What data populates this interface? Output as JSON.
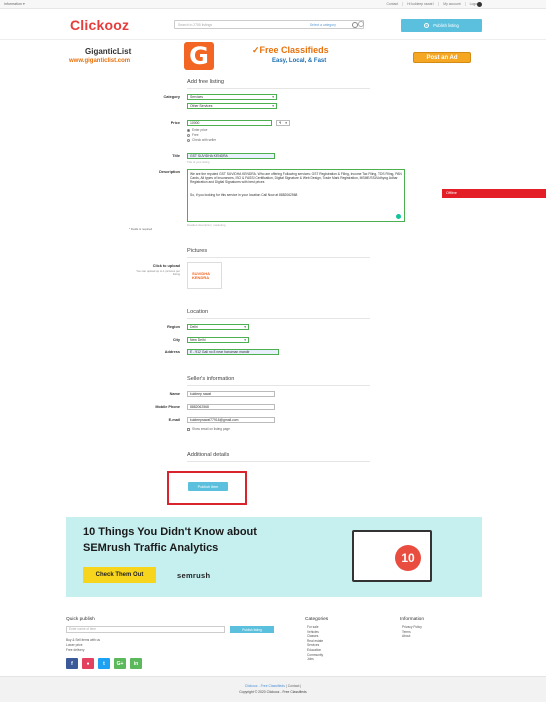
{
  "topbar": {
    "info": "Information ▾",
    "links": [
      "Contact",
      "Hi kuldeep rawat !",
      "My account",
      "Logout"
    ]
  },
  "header": {
    "logo": "Clickooz",
    "search_placeholder": "Search in 2755 listings",
    "search_category": "Select a category",
    "publish_listing": "Publish listing"
  },
  "banner": {
    "site_name": "GiganticList",
    "site_url": "www.giganticlist.com",
    "logo_letter": "G",
    "headline": "✓Free Classifieds",
    "tagline": "Easy, Local, & Fast",
    "post_ad": "Post an Ad"
  },
  "form": {
    "section_title": "Add free listing",
    "category_label": "Category",
    "category_value": "Services",
    "subcategory_value": "Other Services",
    "price_label": "Price",
    "price_value": "10000",
    "currency": "₹",
    "price_options": [
      "Enter price",
      "Free",
      "Check with seller"
    ],
    "title_label": "Title",
    "title_value": "GST SUVIDHA KENDRA",
    "title_hint": "Title of your listing",
    "description_label": "Description",
    "description_p1": "We are the reputed GST SUVIDHA KENDRA. Who are offering Following services: GST Registration & Filing, Income Tax Filing, TDS Filing, PAN Cards, All types of Insurances, ISO & FASSI Certification, Digital Signature & Web Design, Trade Mark Registration, MSME/SSI/Udhyog Adhar Registration and Digital Signatures with best prices",
    "description_p2": "So, if you looking for this service in your location Call Now at 8882062568",
    "description_hint": "Detailed description, marketing",
    "required_note": "* Fields is required",
    "pictures_title": "Pictures",
    "upload_label": "Click to upload",
    "upload_hint": "You can upload up to 1 pictures per listing",
    "thumb_text": "SUVIDHA KENDRA",
    "location_title": "Location",
    "region_label": "Region",
    "region_value": "Delhi",
    "city_label": "City",
    "city_value": "New Delhi",
    "address_label": "Address",
    "address_value": "E - 912 Gali no 8 near hanuman mandir",
    "seller_title": "Seller's information",
    "name_label": "Name",
    "name_value": "kuldeep rawat",
    "phone_label": "Mobile Phone",
    "phone_value": "8882062568",
    "email_label": "E-mail",
    "email_value": "kuldeeprawat77916@gmail.com",
    "show_email": "Show email on listing page",
    "additional_title": "Additional details",
    "publish_item": "Publish item"
  },
  "offline": "Offline",
  "ad": {
    "line1": "10 Things You Didn't Know about",
    "line2": "SEMrush Traffic Analytics",
    "cta": "Check Them Out",
    "brand": "semrush",
    "badge": "10"
  },
  "footer": {
    "quick_title": "Quick publish",
    "quick_placeholder": "Enter name of item",
    "quick_button": "Publish listing",
    "buy_sell": "Buy & Sell items with us",
    "lower_price": "Lower price",
    "free_delivery": "Free delivery",
    "social": [
      "f",
      "●",
      "t",
      "G+",
      "in"
    ],
    "categories_title": "Categories",
    "categories": [
      "For sale",
      "Vehicles",
      "Classes",
      "Real estate",
      "Services",
      "Education",
      "Community",
      "Jobs"
    ],
    "info_title": "Information",
    "info": [
      "Privacy Policy",
      "Terms",
      "About"
    ],
    "bottom_links": "Clickooz - Free Classifieds",
    "bottom_contact": "| Contact |",
    "copyright": "Copyright © 2020 Clickooz - Free Classifieds"
  },
  "colors": {
    "brand": "#e83c3c",
    "accent": "#5bc0de",
    "field_ok": "#4caf50",
    "highlight_box": "#d9232d",
    "offline": "#e41e26"
  }
}
